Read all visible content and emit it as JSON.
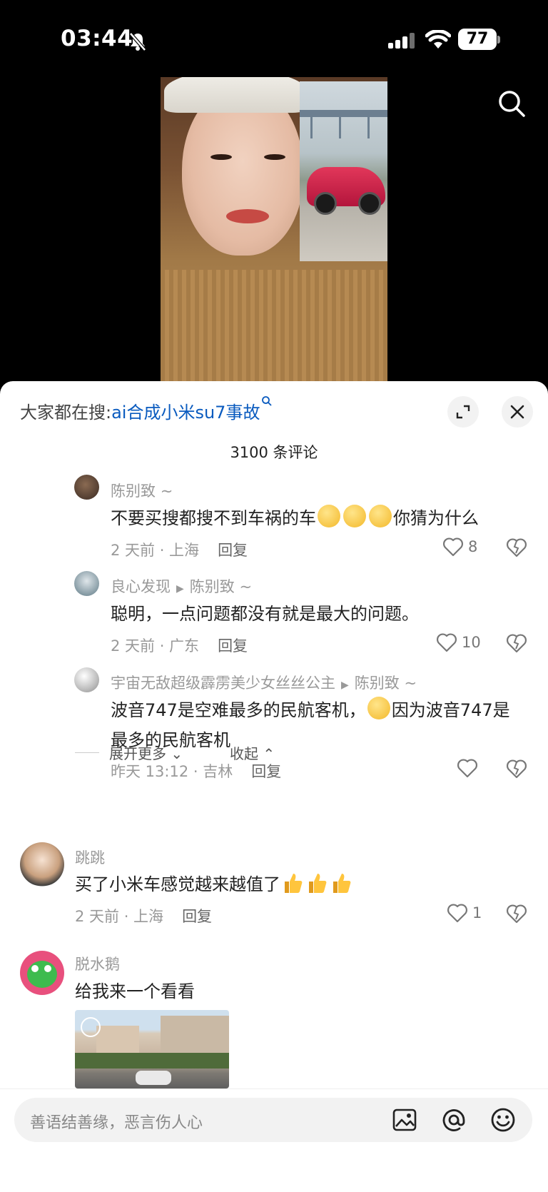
{
  "status": {
    "time": "03:44",
    "battery": "77"
  },
  "video": {},
  "panel": {
    "hot_search_label": "大家都在搜:",
    "hot_search_keyword": "ai合成小米su7事故",
    "comment_count": "3100 条评论"
  },
  "replies": [
    {
      "name": "陈别致",
      "suffix": "~",
      "text": "不要买搜都搜不到车祸的车",
      "text_after": "你猜为什么",
      "meta": "2 天前 · 上海",
      "reply": "回复",
      "likes": "8"
    },
    {
      "name": "良心发现",
      "reply_to": "陈别致",
      "suffix": "~",
      "text": "聪明，一点问题都没有就是最大的问题。",
      "meta": "2 天前 · 广东",
      "reply": "回复",
      "likes": "10"
    },
    {
      "name": "宇宙无敌超级霹雳美少女丝丝公主",
      "reply_to": "陈别致",
      "suffix": "~",
      "text_line1a": "波音747是空难最多的民航客机，",
      "text_line1b": "因为波音747是",
      "text_line2": "最多的民航客机",
      "meta": "昨天 13:12 · 吉林",
      "reply": "回复",
      "likes": ""
    }
  ],
  "thread_controls": {
    "expand": "展开更多",
    "collapse": "收起"
  },
  "comments": [
    {
      "name": "跳跳",
      "text": "买了小米车感觉越来越值了",
      "meta": "2 天前 · 上海",
      "reply": "回复",
      "likes": "1"
    },
    {
      "name": "脱水鹅",
      "text": "给我来一个看看"
    }
  ],
  "input": {
    "placeholder": "善语结善缘，恶言伤人心"
  },
  "colors": {
    "link": "#0a5bbf",
    "muted": "#999999",
    "sheet": "#ffffff"
  }
}
